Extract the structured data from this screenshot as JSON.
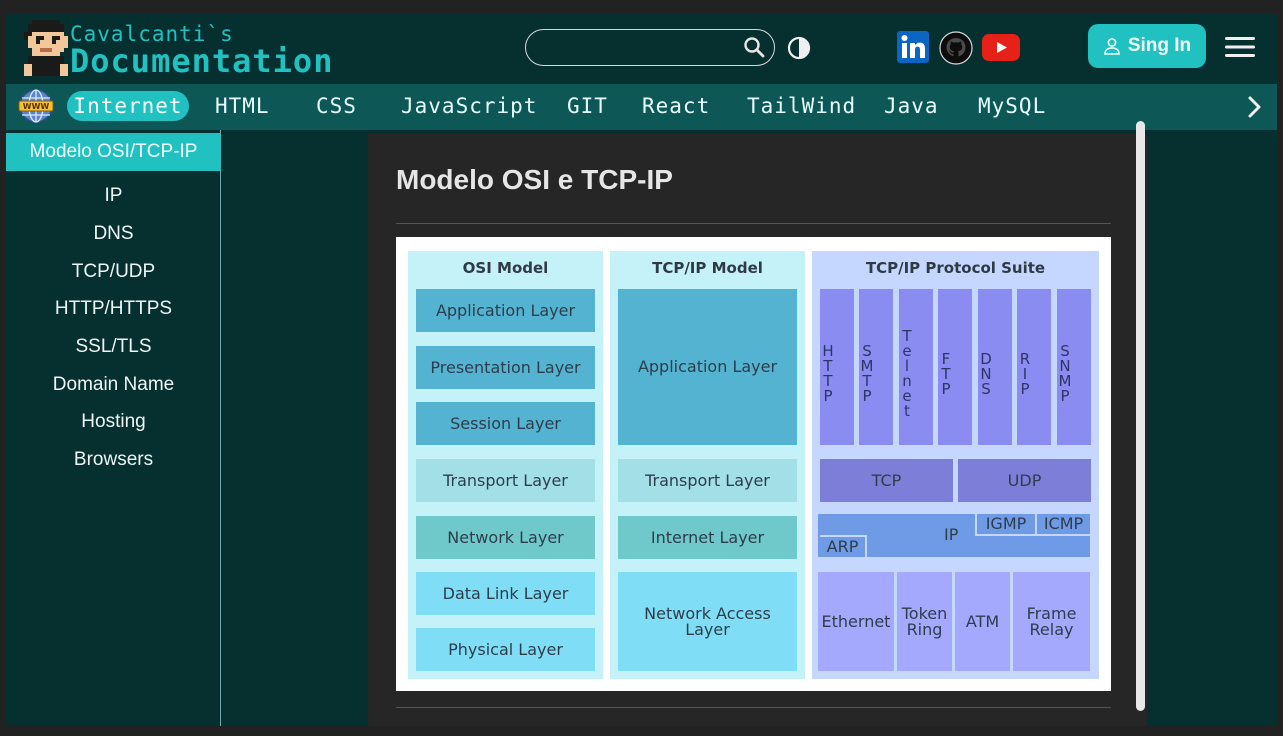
{
  "header": {
    "logo_line1": "Cavalcanti`s",
    "logo_line2": "Documentation",
    "search_value": "",
    "icons": [
      "search-icon",
      "contrast-icon",
      "linkedin-icon",
      "github-icon",
      "youtube-icon",
      "user-icon",
      "menu-icon"
    ],
    "signin_label": "Sing In"
  },
  "nav": {
    "items": [
      "Internet",
      "HTML",
      "CSS",
      "JavaScript",
      "GIT",
      "React",
      "TailWind",
      "Java",
      "MySQL"
    ],
    "active": "Internet"
  },
  "sidebar": {
    "active": "Modelo OSI/TCP-IP",
    "items": [
      "IP",
      "DNS",
      "TCP/UDP",
      "HTTP/HTTPS",
      "SSL/TLS",
      "Domain Name",
      "Hosting",
      "Browsers"
    ]
  },
  "main": {
    "title": "Modelo OSI e TCP-IP"
  },
  "diagram": {
    "osi": {
      "title": "OSI Model",
      "layers": [
        "Application Layer",
        "Presentation Layer",
        "Session Layer",
        "Transport Layer",
        "Network Layer",
        "Data Link Layer",
        "Physical Layer"
      ]
    },
    "tcpip": {
      "title": "TCP/IP Model",
      "layers": [
        "Application Layer",
        "Transport Layer",
        "Internet Layer",
        "Network Access Layer"
      ]
    },
    "suite": {
      "title": "TCP/IP Protocol Suite",
      "app_protocols": [
        "HTTP",
        "SMTP",
        "Telnet",
        "FTP",
        "DNS",
        "RIP",
        "SNMP"
      ],
      "transport": [
        "TCP",
        "UDP"
      ],
      "internet": [
        "IP",
        "ARP",
        "IGMP",
        "ICMP"
      ],
      "network_access": [
        "Ethernet",
        "Token Ring",
        "ATM",
        "Frame Relay"
      ]
    }
  },
  "colors": {
    "background": "#063030",
    "nav": "#0e5757",
    "accent": "#21c1c1",
    "content_bg": "#262626"
  }
}
